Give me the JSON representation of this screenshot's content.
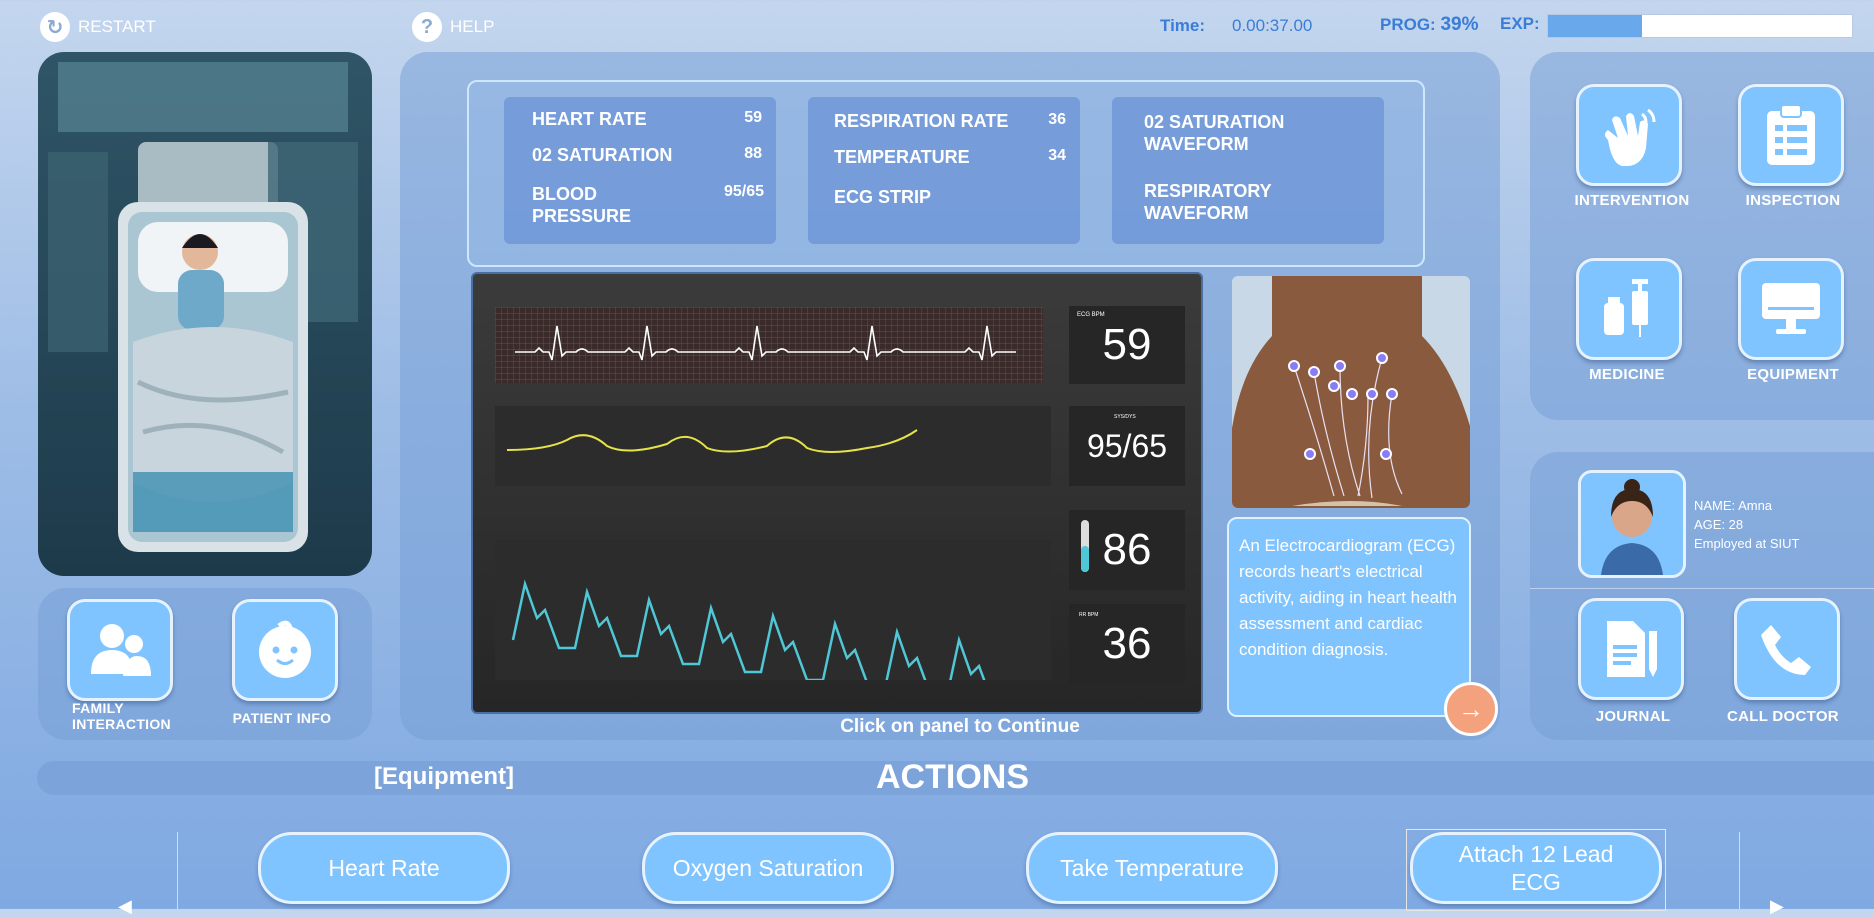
{
  "topbar": {
    "restart_label": "RESTART",
    "help_label": "HELP",
    "time_label": "Time:",
    "time_value": "0.00:37.00",
    "prog_label": "PROG:",
    "prog_value": "39%",
    "exp_label": "EXP:",
    "exp_progress": 0.31
  },
  "side_left": {
    "family_label": "FAMILY INTERACTION",
    "patient_info_label": "PATIENT INFO"
  },
  "vitals": {
    "col1": [
      {
        "label": "HEART RATE",
        "value": "59"
      },
      {
        "label": "02 SATURATION",
        "value": "88"
      },
      {
        "label": "BLOOD PRESSURE",
        "value": "95/65"
      }
    ],
    "col2": [
      {
        "label": "RESPIRATION RATE",
        "value": "36"
      },
      {
        "label": "TEMPERATURE",
        "value": "34"
      },
      {
        "label": "ECG STRIP",
        "value": ""
      }
    ],
    "col3": [
      {
        "label": "02 SATURATION WAVEFORM"
      },
      {
        "label": "RESPIRATORY WAVEFORM"
      }
    ]
  },
  "monitor": {
    "hr_value": "59",
    "bp_value": "95/65",
    "spo2_value": "86",
    "rr_value": "36",
    "ecg_small": "ECG BPM",
    "bp_small": "SYS/DYS",
    "rr_small": "RR BPM"
  },
  "info_card": {
    "text": "An Electrocardiogram (ECG) records heart's electrical activity, aiding in heart health assessment and cardiac condition diagnosis."
  },
  "continue_text": "Click on panel to Continue",
  "right_tools": {
    "intervention": "INTERVENTION",
    "inspection": "INSPECTION",
    "medicine": "MEDICINE",
    "equipment": "EQUIPMENT"
  },
  "nurse": {
    "name": "NAME: Amna",
    "age": "AGE: 28",
    "employer": "Employed at SIUT"
  },
  "right_bottom": {
    "journal": "JOURNAL",
    "call_doctor": "CALL DOCTOR"
  },
  "actions_bar": {
    "category": "[Equipment]",
    "title": "ACTIONS"
  },
  "actions": [
    {
      "label": "Heart Rate"
    },
    {
      "label": "Oxygen Saturation"
    },
    {
      "label": "Take Temperature"
    },
    {
      "label": "Attach 12 Lead ECG"
    }
  ],
  "colors": {
    "accent": "#7fc3ff",
    "exp_fill": "#6aa8ec",
    "ecg_line": "#ffffff",
    "resp_wave": "#e6e34a",
    "spo2_wave": "#4fc7d6",
    "next_button": "#f4a27e"
  }
}
